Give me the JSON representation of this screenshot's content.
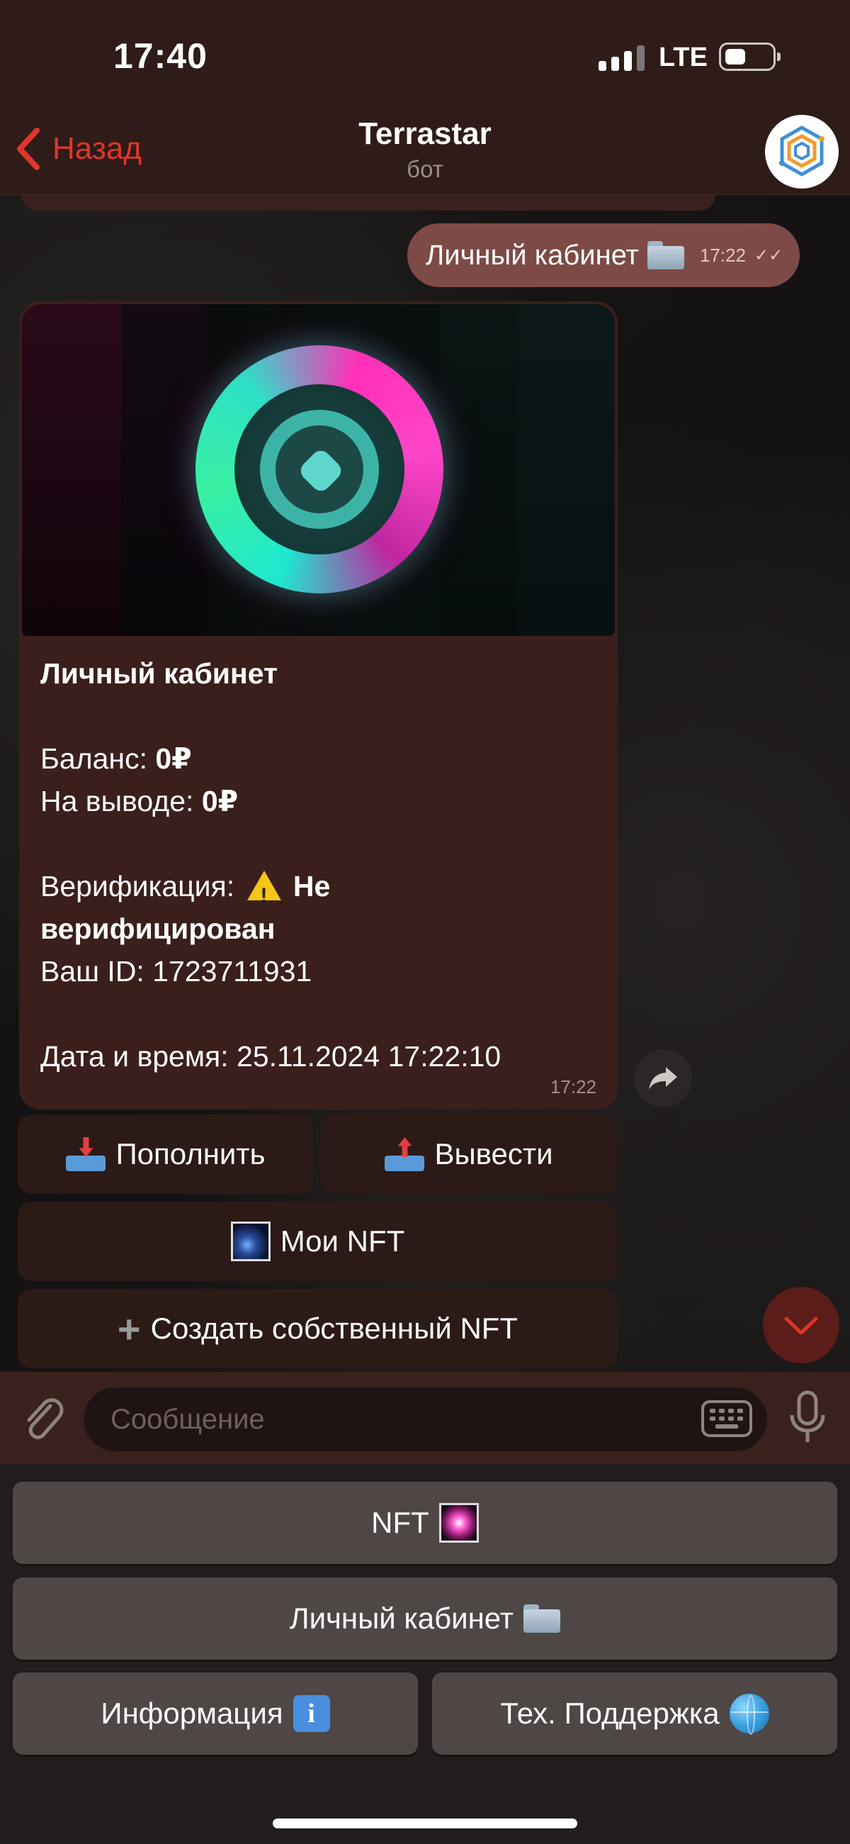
{
  "status": {
    "time": "17:40",
    "network": "LTE"
  },
  "nav": {
    "back_label": "Назад",
    "title": "Terrastar",
    "subtitle": "бот"
  },
  "chat": {
    "outgoing": {
      "text": "Личный кабинет",
      "icon": "folder-icon",
      "time": "17:22"
    },
    "card": {
      "heading": "Личный кабинет",
      "balance_label": "Баланс:",
      "balance_value": "0₽",
      "withdraw_label": "На выводе:",
      "withdraw_value": "0₽",
      "verification_label": "Верификация:",
      "verification_value": "Не верифицирован",
      "id_label": "Ваш ID:",
      "id_value": "1723711931",
      "datetime_label": "Дата и время:",
      "datetime_value": "25.11.2024 17:22:10",
      "time": "17:22"
    },
    "inline_buttons": {
      "deposit": "Пополнить",
      "withdraw": "Вывести",
      "my_nft": "Мои NFT",
      "create_nft": "Создать собственный NFT"
    }
  },
  "input": {
    "placeholder": "Сообщение"
  },
  "keyboard": {
    "nft": "NFT",
    "cabinet": "Личный кабинет",
    "info": "Информация",
    "support": "Тех. Поддержка"
  },
  "colors": {
    "accent": "#e0352b",
    "bubble_out": "#7d4a45",
    "header": "#2f1b18"
  }
}
